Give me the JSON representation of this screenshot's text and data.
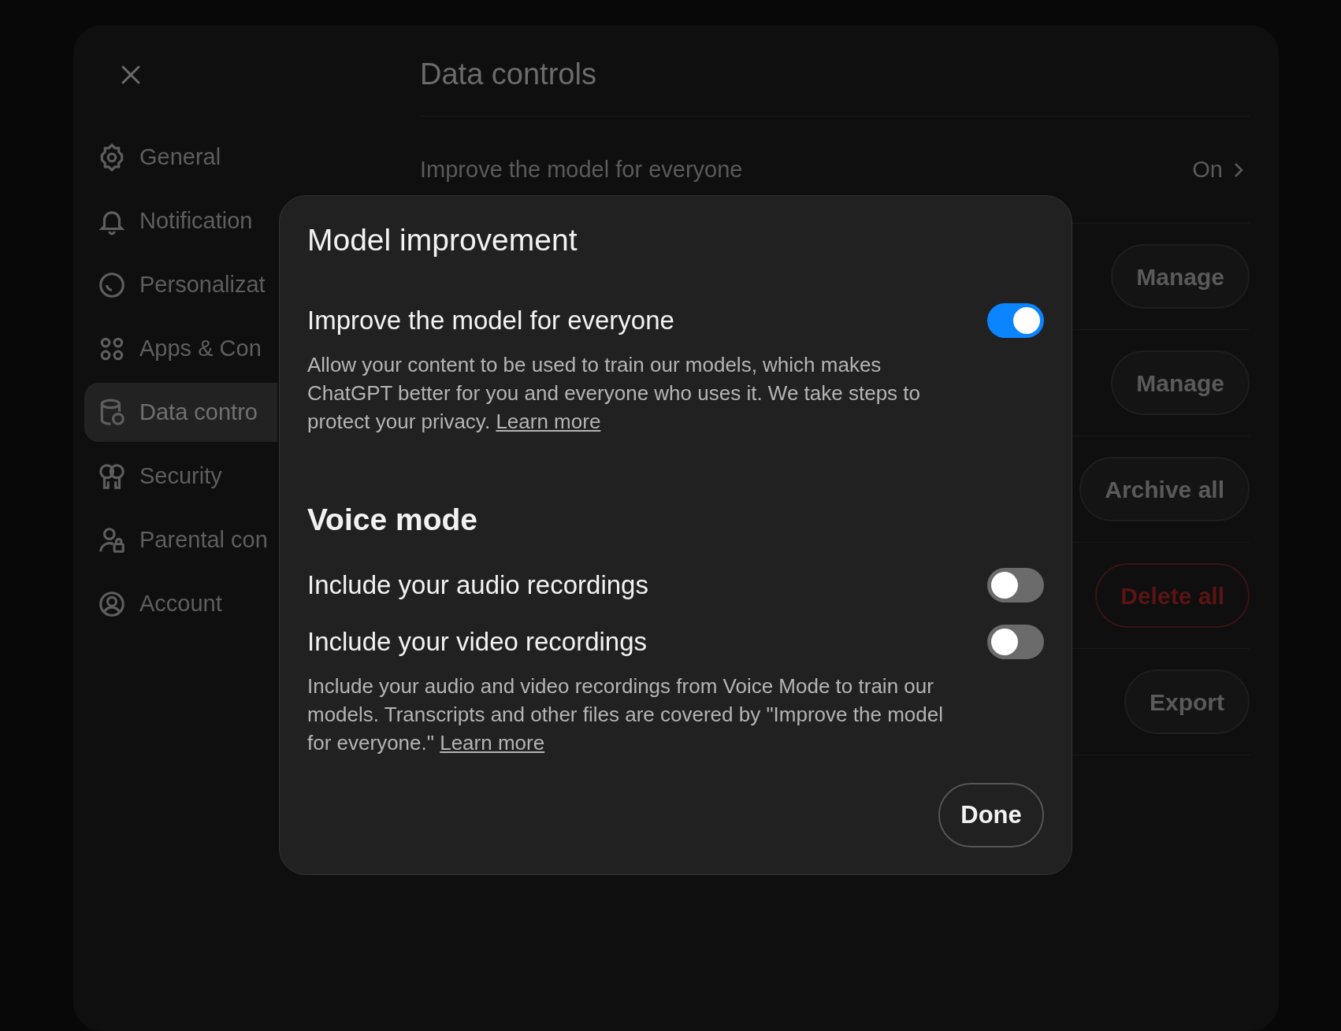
{
  "background": {
    "sidebar": {
      "items": [
        {
          "label": "General",
          "selected": false
        },
        {
          "label": "Notification",
          "selected": false
        },
        {
          "label": "Personalizat",
          "selected": false
        },
        {
          "label": "Apps & Con",
          "selected": false
        },
        {
          "label": "Data contro",
          "selected": true
        },
        {
          "label": "Security",
          "selected": false
        },
        {
          "label": "Parental con",
          "selected": false
        },
        {
          "label": "Account",
          "selected": false
        }
      ]
    },
    "title": "Data controls",
    "rows": [
      {
        "kind": "value",
        "label": "Improve the model for everyone",
        "value": "On"
      },
      {
        "kind": "button",
        "button": "Manage",
        "danger": false
      },
      {
        "kind": "button",
        "button": "Manage",
        "danger": false
      },
      {
        "kind": "button",
        "button": "Archive all",
        "danger": false
      },
      {
        "kind": "button",
        "button": "Delete all",
        "danger": true
      },
      {
        "kind": "button",
        "button": "Export",
        "danger": false
      }
    ]
  },
  "dialog": {
    "title": "Model improvement",
    "sections": [
      {
        "settings": [
          {
            "label": "Improve the model for everyone",
            "on": true
          }
        ],
        "description": "Allow your content to be used to train our models, which makes ChatGPT better for you and everyone who uses it. We take steps to protect your privacy.",
        "link": "Learn more"
      },
      {
        "heading": "Voice mode",
        "settings": [
          {
            "label": "Include your audio recordings",
            "on": false
          },
          {
            "label": "Include your video recordings",
            "on": false
          }
        ],
        "description": "Include your audio and video recordings from Voice Mode to train our models. Transcripts and other files are covered by \"Improve the model for everyone.\"",
        "link": "Learn more"
      }
    ],
    "button": "Done"
  }
}
